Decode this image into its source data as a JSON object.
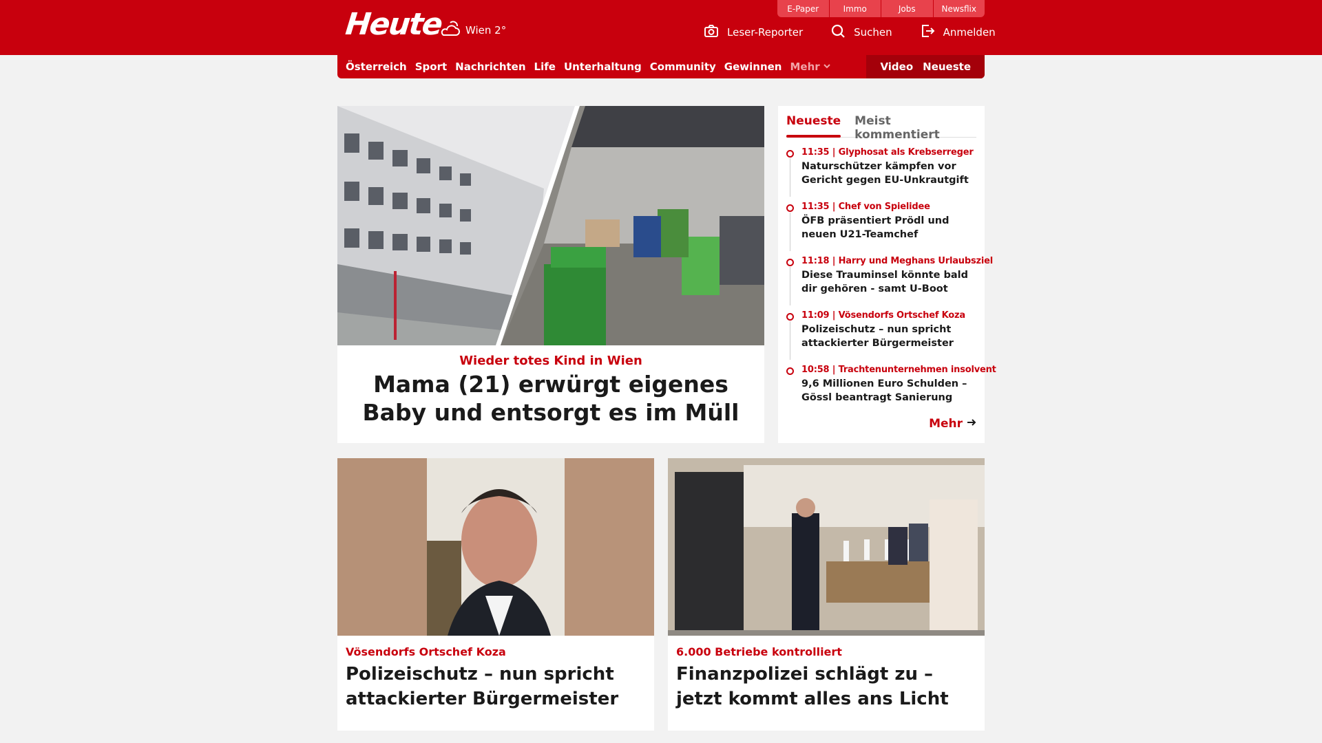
{
  "header": {
    "logo_text": "Heute",
    "weather": {
      "icon": "cloud-sun-icon",
      "label": "Wien 2°"
    },
    "top_links": [
      "E-Paper",
      "Immo",
      "Jobs",
      "Newsflix"
    ],
    "actions": [
      {
        "icon": "camera-icon",
        "label": "Leser-Reporter"
      },
      {
        "icon": "search-icon",
        "label": "Suchen"
      },
      {
        "icon": "login-icon",
        "label": "Anmelden"
      }
    ]
  },
  "nav": {
    "items": [
      "Österreich",
      "Sport",
      "Nachrichten",
      "Life",
      "Unterhaltung",
      "Community",
      "Gewinnen"
    ],
    "more_label": "Mehr",
    "right": [
      "Video",
      "Neueste"
    ]
  },
  "hero": {
    "kicker": "Wieder totes Kind in Wien",
    "headline": "Mama (21) erwürgt eigenes Baby und entsorgt es im Müll"
  },
  "sidebar": {
    "tabs": [
      "Neueste",
      "Meist kommentiert"
    ],
    "items": [
      {
        "time": "11:35",
        "tag": "Glyphosat als Krebserreger",
        "title": "Naturschützer kämpfen vor Gericht gegen EU-Unkrautgift"
      },
      {
        "time": "11:35",
        "tag": "Chef von Spielidee",
        "title": "ÖFB präsentiert Prödl und neuen U21-Teamchef"
      },
      {
        "time": "11:18",
        "tag": "Harry und Meghans Urlaubsziel",
        "title": "Diese Trauminsel könnte bald dir gehören - samt U-Boot"
      },
      {
        "time": "11:09",
        "tag": "Vösendorfs Ortschef Koza",
        "title": "Polizeischutz – nun spricht attackierter Bürgermeister"
      },
      {
        "time": "10:58",
        "tag": "Trachtenunternehmen insolvent",
        "title": "9,6 Millionen Euro Schulden – Gössl beantragt Sanierung"
      }
    ],
    "more_label": "Mehr"
  },
  "cards": [
    {
      "kicker": "Vösendorfs Ortschef Koza",
      "headline": "Polizeischutz – nun spricht attackierter Bürgermeister"
    },
    {
      "kicker": "6.000 Betriebe kontrolliert",
      "headline": "Finanzpolizei schlägt zu – jetzt kommt alles ans Licht"
    }
  ],
  "colors": {
    "brand": "#c8000d",
    "background": "#f2f2f2"
  }
}
